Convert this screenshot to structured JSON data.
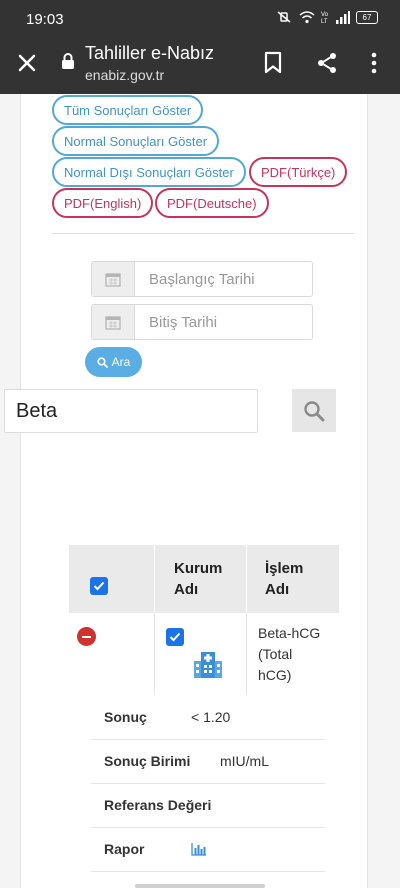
{
  "status_bar": {
    "time": "19:03",
    "battery": "67"
  },
  "browser": {
    "title": "Tahliller e-Nabız",
    "url": "enabiz.gov.tr"
  },
  "filters": {
    "all_results": "Tüm Sonuçları Göster",
    "normal_results": "Normal Sonuçları Göster",
    "abnormal_results": "Normal Dışı Sonuçları Göster",
    "pdf_turkish": "PDF(Türkçe)",
    "pdf_english": "PDF(English)",
    "pdf_german": "PDF(Deutsche)"
  },
  "date_search": {
    "start_placeholder": "Başlangıç Tarihi",
    "end_placeholder": "Bitiş Tarihi",
    "search_button": "Ara"
  },
  "search": {
    "value": "Beta"
  },
  "table": {
    "headers": {
      "institution_line1": "Kurum",
      "institution_line2": "Adı",
      "operation_line1": "İşlem",
      "operation_line2": "Adı"
    },
    "row": {
      "operation_line1": "Beta-hCG",
      "operation_line2": "(Total",
      "operation_line3": "hCG)"
    }
  },
  "details": {
    "result_label": "Sonuç",
    "result_value": "< 1.20",
    "unit_label": "Sonuç Birimi",
    "unit_value": "mIU/mL",
    "reference_label": "Referans Değeri",
    "report_label": "Rapor"
  },
  "colors": {
    "blue_button": "#53a8d6",
    "red_button": "#c8335b",
    "search_button": "#5aaee3",
    "checkbox": "#1a73e8"
  }
}
